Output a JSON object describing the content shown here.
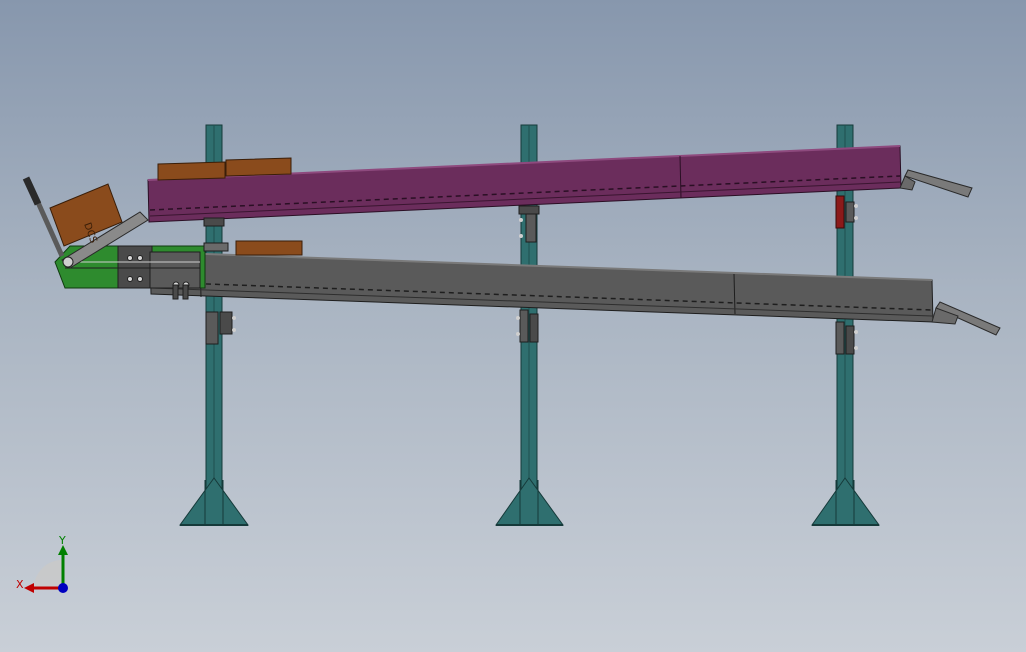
{
  "viewport": {
    "background_top": "#8797ad",
    "background_bottom": "#c9cfd7"
  },
  "model": {
    "post_color": "#2f6f6f",
    "post_edge": "#163a3a",
    "upper_conveyor_color": "#6b2d5c",
    "lower_conveyor_color": "#595959",
    "box_color": "#8a4b1c",
    "feeder_color": "#2e8b2e",
    "bracket_color": "#8b1a1a",
    "box_label": "DCS"
  },
  "triad": {
    "x_label": "X",
    "y_label": "Y",
    "x_color": "#c00000",
    "y_color": "#008000",
    "z_color": "#0000c0"
  }
}
